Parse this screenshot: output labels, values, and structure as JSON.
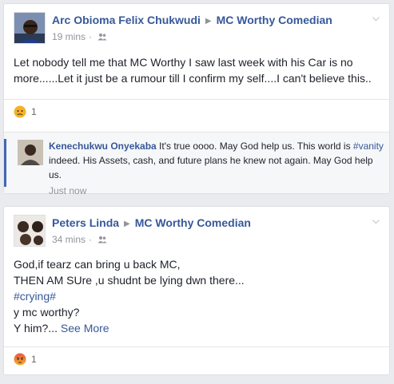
{
  "posts": [
    {
      "author": "Arc Obioma Felix Chukwudi",
      "page": "MC Worthy Comedian",
      "time": "19 mins",
      "dot": "·",
      "lines": [
        "Let nobody tell me that MC Worthy I saw last week with his Car is no",
        "more......Let it just be a rumour till I confirm my self....I can't believe this.."
      ],
      "reaction_count": "1",
      "reaction_icon": "sad-emoji-icon",
      "comment": {
        "author": "Kenechukwu Onyekaba",
        "text_before": " It's true oooo. May God help us. This world is ",
        "hashtag": "#vanity",
        "text_after": " indeed. His Assets, cash, and future plans he knew not again. May God help us.",
        "time": "Just now"
      }
    },
    {
      "author": "Peters Linda",
      "page": "MC Worthy Comedian",
      "time": "34 mins",
      "dot": "·",
      "lines": [
        "God,if tearz can bring u back MC,",
        "THEN AM SUre ,u shudnt be lying dwn there...",
        "#crying#",
        "y mc worthy?",
        "Y him?..."
      ],
      "see_more": "See More",
      "reaction_count": "1",
      "reaction_icon": "angry-emoji-icon"
    }
  ],
  "colors": {
    "link": "#365899",
    "meta": "#90949c",
    "comment_accent": "#4267b2",
    "background": "#e9ebee"
  }
}
